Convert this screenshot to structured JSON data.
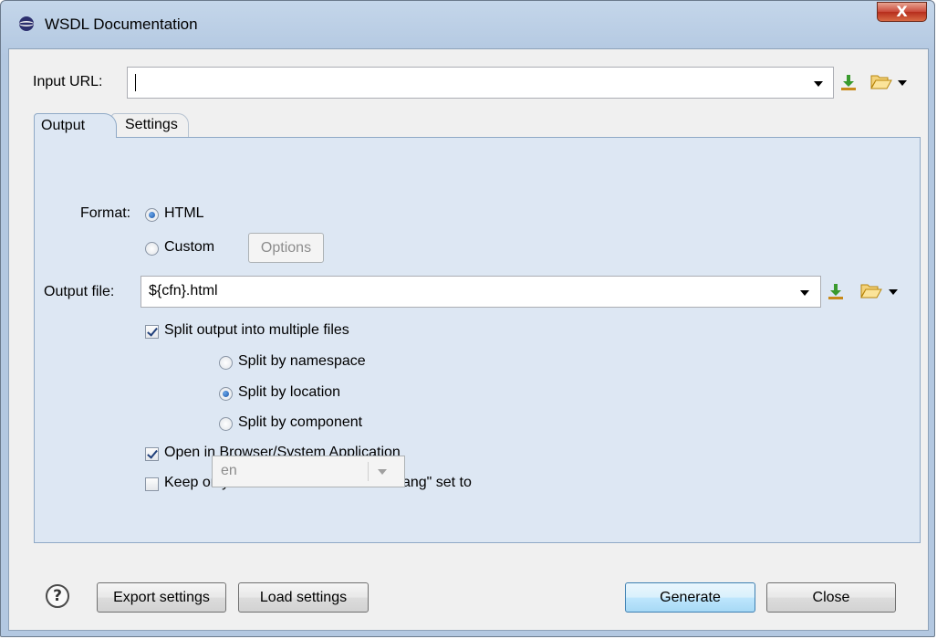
{
  "window": {
    "title": "WSDL Documentation",
    "close_label": "X"
  },
  "input_url": {
    "label": "Input URL:",
    "value": ""
  },
  "tabs": [
    {
      "label": "Output",
      "active": true
    },
    {
      "label": "Settings",
      "active": false
    }
  ],
  "format": {
    "label": "Format:",
    "options": [
      {
        "label": "HTML",
        "selected": true
      },
      {
        "label": "Custom",
        "selected": false
      }
    ],
    "options_button": "Options"
  },
  "output_file": {
    "label": "Output file:",
    "value": "${cfn}.html"
  },
  "split": {
    "label": "Split output into multiple files",
    "checked": true,
    "options": [
      {
        "label": "Split by namespace",
        "selected": false
      },
      {
        "label": "Split by location",
        "selected": true
      },
      {
        "label": "Split by component",
        "selected": false
      }
    ]
  },
  "open_in_browser": {
    "label": "Open in Browser/System Application",
    "checked": true
  },
  "keep_annotations": {
    "label": "Keep only the annotations with \"xml:lang\" set to",
    "checked": false,
    "lang_value": "en"
  },
  "footer": {
    "export_label": "Export settings",
    "load_label": "Load settings",
    "generate_label": "Generate",
    "close_label": "Close",
    "help_label": "?"
  },
  "colors": {
    "panel_bg": "#dde7f3",
    "accent": "#3c7fb1",
    "frame": "#b3c8e1"
  },
  "icons": [
    "app-icon",
    "download-icon",
    "folder-open-icon",
    "chevron-down-icon",
    "help-icon"
  ]
}
